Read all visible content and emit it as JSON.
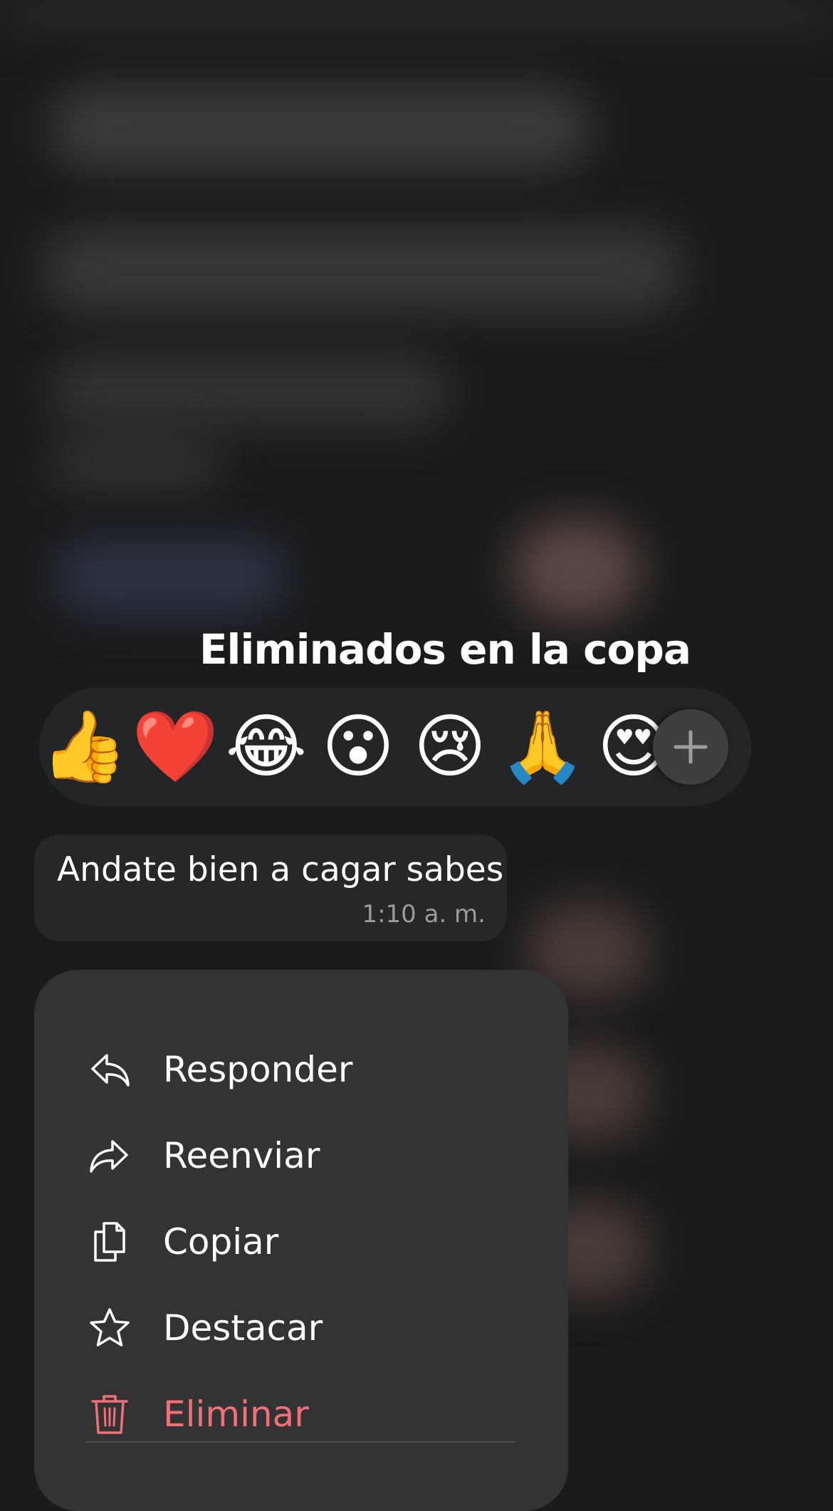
{
  "chat": {
    "title": "Eliminados en la copa"
  },
  "reactions": {
    "emojis": [
      {
        "name": "thumbs-up",
        "glyph": "👍"
      },
      {
        "name": "red-heart",
        "glyph": "❤️"
      },
      {
        "name": "tears-of-joy",
        "glyph": "😂"
      },
      {
        "name": "surprised",
        "glyph": "😮"
      },
      {
        "name": "crying",
        "glyph": "😢"
      },
      {
        "name": "folded-hands",
        "glyph": "🙏"
      },
      {
        "name": "heart-eyes",
        "glyph": "😍"
      }
    ],
    "more_icon": "plus-icon"
  },
  "message": {
    "text": "Andate bien a cagar sabes",
    "time": "1:10 a. m."
  },
  "menu": {
    "items": [
      {
        "label": "Responder",
        "icon": "reply-icon"
      },
      {
        "label": "Reenviar",
        "icon": "forward-icon"
      },
      {
        "label": "Copiar",
        "icon": "copy-icon"
      },
      {
        "label": "Destacar",
        "icon": "star-icon"
      },
      {
        "label": "Eliminar",
        "icon": "trash-icon"
      }
    ]
  },
  "colors": {
    "background": "#1b1b1c",
    "menu_background": "#333334",
    "danger": "#f0707a",
    "bubble": "#262728"
  }
}
